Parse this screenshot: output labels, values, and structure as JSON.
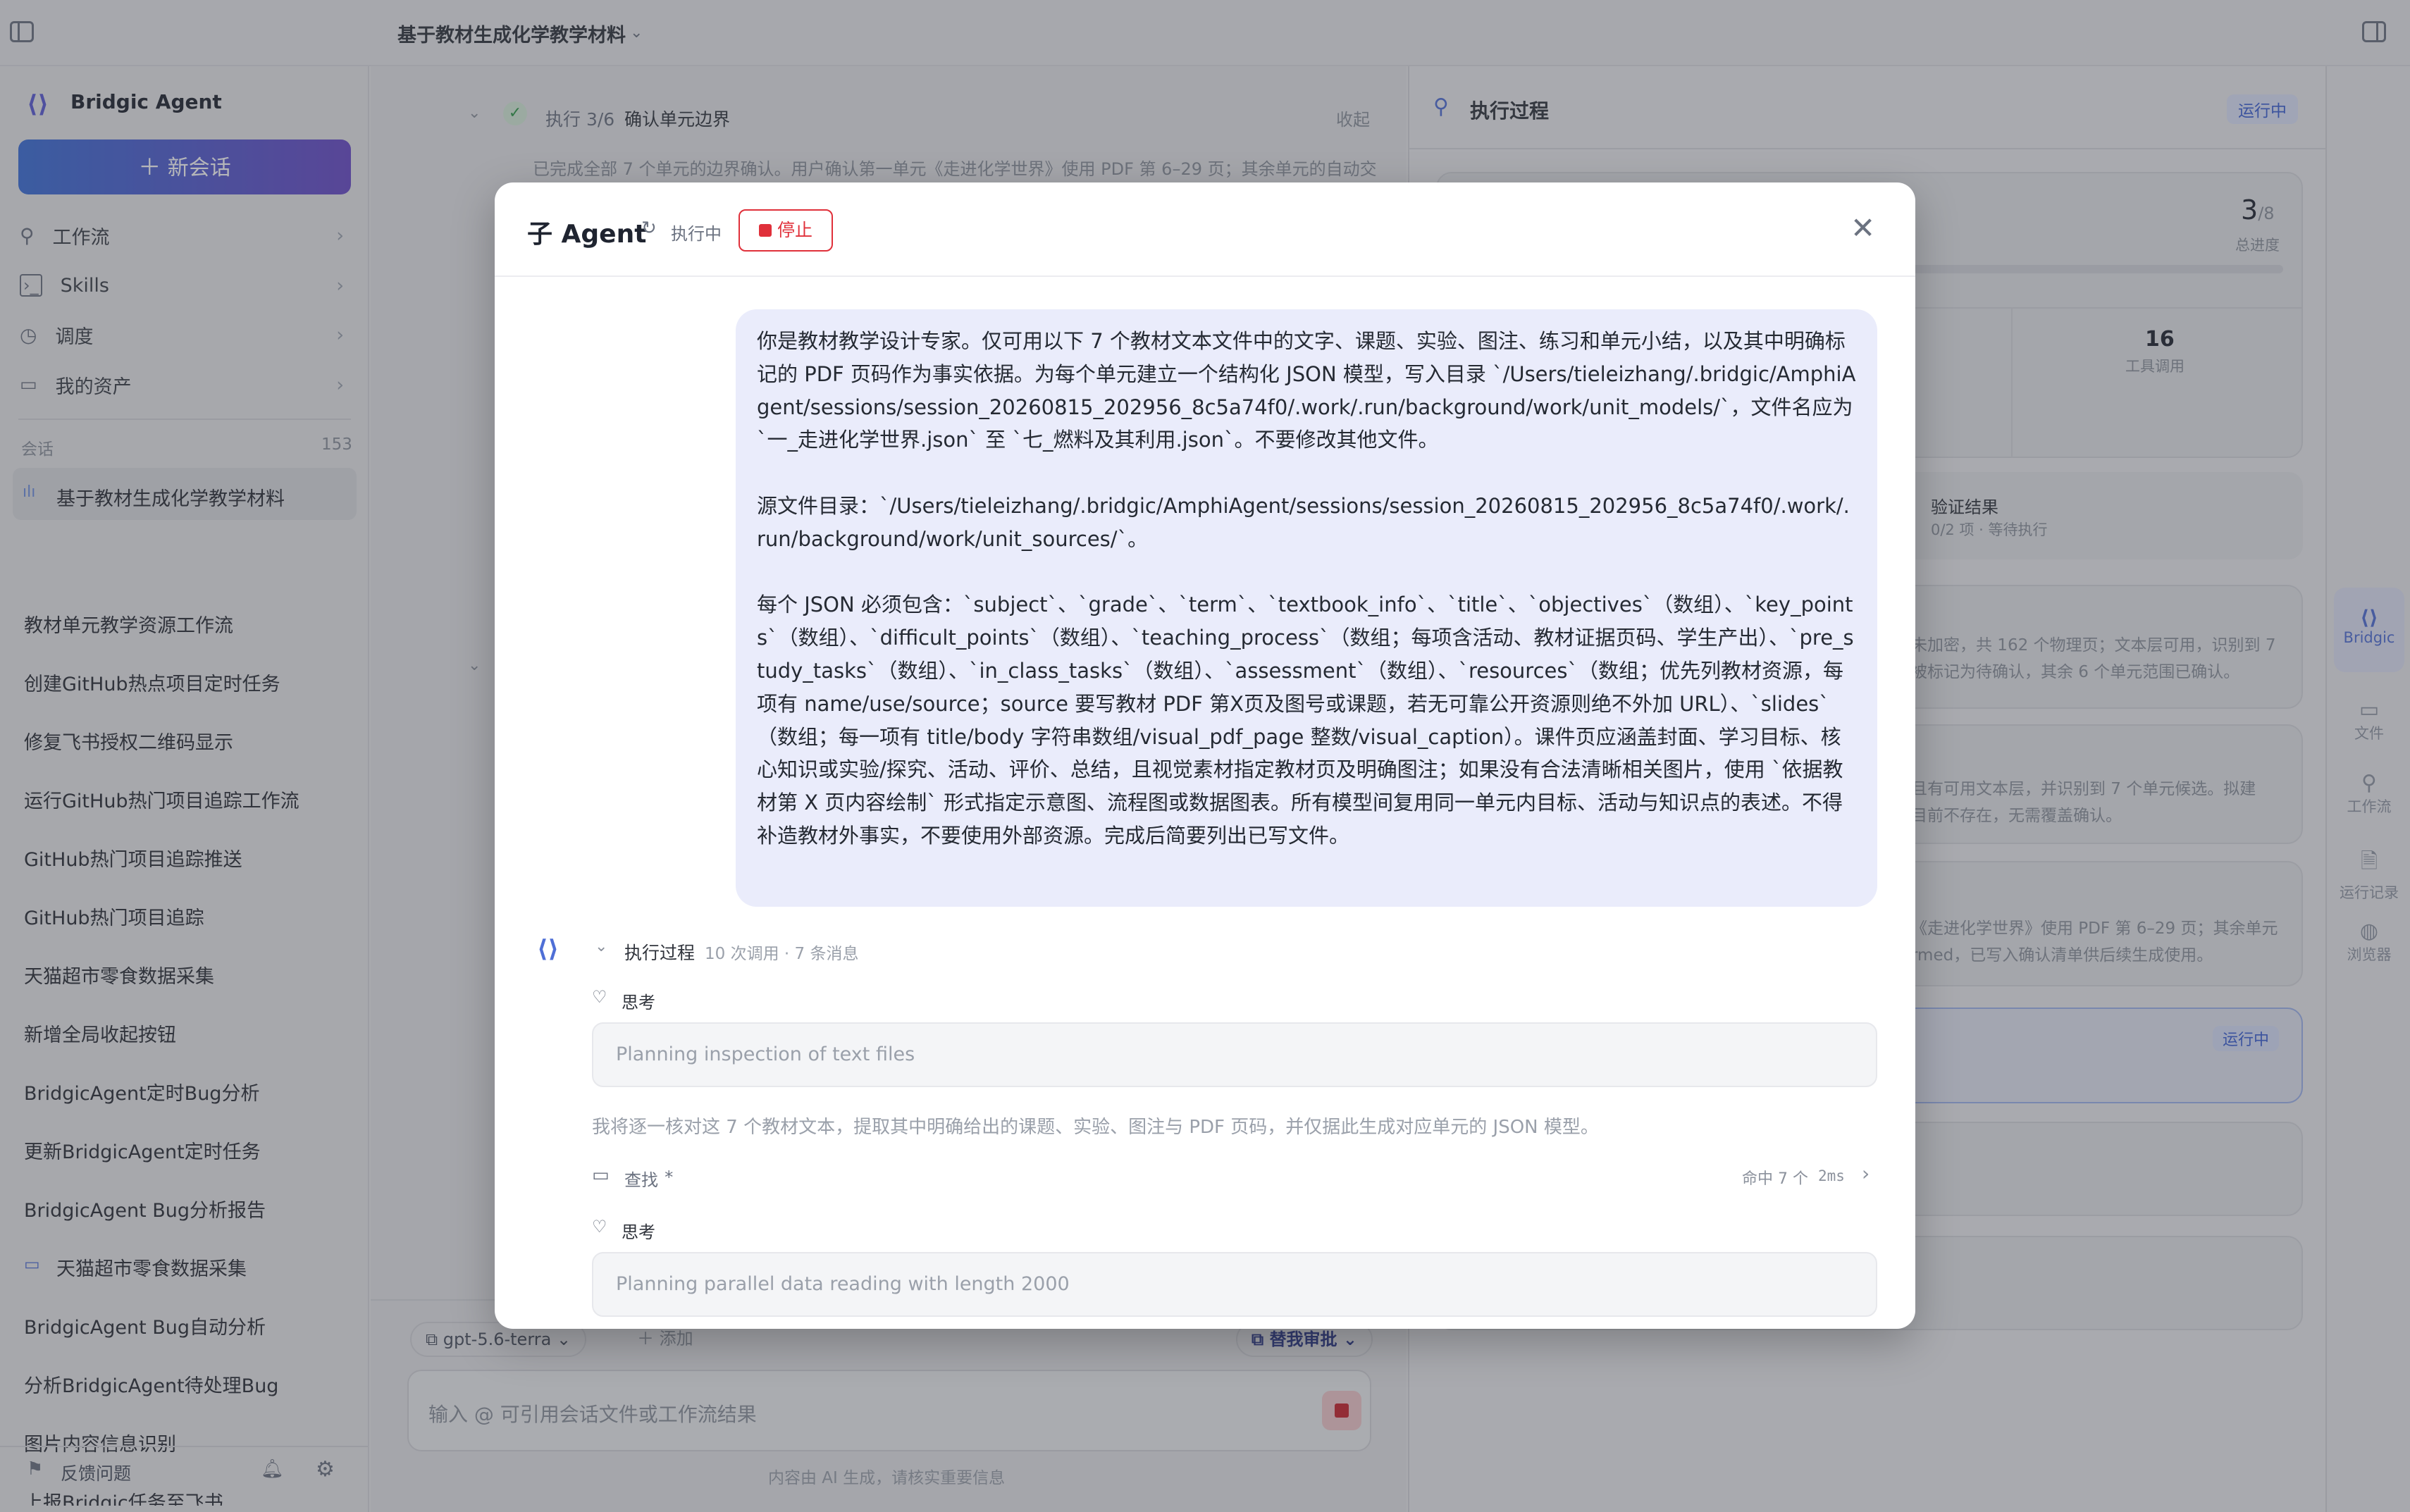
{
  "topbar": {
    "title": "基于教材生成化学教学材料"
  },
  "sidebar": {
    "brand": "Bridgic Agent",
    "new_chat": "新会话",
    "nav": [
      {
        "label": "工作流",
        "icon": "workflow-icon"
      },
      {
        "label": "Skills",
        "icon": "terminal-icon"
      },
      {
        "label": "调度",
        "icon": "clock-icon"
      },
      {
        "label": "我的资产",
        "icon": "folder-icon"
      }
    ],
    "section_label": "会话",
    "count": "153",
    "conversations": [
      "基于教材生成化学教学材料",
      "教材单元教学资源工作流",
      "创建GitHub热点项目定时任务",
      "修复飞书授权二维码显示",
      "运行GitHub热门项目追踪工作流",
      "GitHub热门项目追踪推送",
      "GitHub热门项目追踪",
      "天猫超市零食数据采集",
      "新增全局收起按钮",
      "BridgicAgent定时Bug分析",
      "更新BridgicAgent定时任务",
      "BridgicAgent Bug分析报告",
      "天猫超市零食数据采集",
      "BridgicAgent Bug自动分析",
      "分析BridgicAgent待处理Bug",
      "图片内容信息识别",
      "上报Bridgic任务至飞书"
    ],
    "feedback": "反馈问题"
  },
  "main": {
    "step_label": "执行 3/6",
    "step_title": "确认单元边界",
    "collapse": "收起",
    "step_desc": "已完成全部 7 个单元的边界确认。用户确认第一单元《走进化学世界》使用 PDF 第 6–29 页；其余单元的自动交",
    "model": "gpt-5.6-terra",
    "add": "添加",
    "approve": "替我审批",
    "input_placeholder": "输入 @ 可引用会话文件或工作流结果",
    "disclaimer": "内容由 AI 生成，请核实重要信息"
  },
  "right_panel": {
    "title": "执行过程",
    "status": "运行中",
    "progress_value": "3",
    "progress_total": "/8",
    "progress_label": "总进度",
    "tool_calls_value": "16",
    "tool_calls_label": "工具调用",
    "verify_title": "验证结果",
    "verify_sub": "0/2 项 · 等待执行",
    "card1_text": "未加密，共 162 个物理页；文本层可用，识别到 7",
    "card1_text2": "被标记为待确认，其余 6 个单元范围已确认。",
    "card2_text": "且有可用文本层，并识别到 7 个单元候选。拟建",
    "card2_text2": "目前不存在，无需覆盖确认。",
    "card3_text": "《走进化学世界》使用 PDF 第 6–29 页；其余单元",
    "card3_text2": "rmed，已写入确认清单供后续生成使用。",
    "card4_status": "运行中"
  },
  "rail": {
    "items": [
      "Bridgic",
      "文件",
      "工作流",
      "运行记录",
      "浏览器"
    ]
  },
  "modal": {
    "title": "子 Agent",
    "state": "执行中",
    "stop": "停止",
    "prompt": "你是教材教学设计专家。仅可用以下 7 个教材文本文件中的文字、课题、实验、图注、练习和单元小结，以及其中明确标记的 PDF 页码作为事实依据。为每个单元建立一个结构化 JSON 模型，写入目录 `/Users/tieleizhang/.bridgic/AmphiAgent/sessions/session_20260815_202956_8c5a74f0/.work/.run/background/work/unit_models/`，文件名应为 `一_走进化学世界.json` 至 `七_燃料及其利用.json`。不要修改其他文件。\n\n源文件目录：`/Users/tieleizhang/.bridgic/AmphiAgent/sessions/session_20260815_202956_8c5a74f0/.work/.run/background/work/unit_sources/`。\n\n每个 JSON 必须包含：`subject`、`grade`、`term`、`textbook_info`、`title`、`objectives`（数组）、`key_points`（数组）、`difficult_points`（数组）、`teaching_process`（数组；每项含活动、教材证据页码、学生产出）、`pre_study_tasks`（数组）、`in_class_tasks`（数组）、`assessment`（数组）、`resources`（数组；优先列教材资源，每项有 name/use/source；source 要写教材 PDF 第X页及图号或课题，若无可靠公开资源则绝不外加 URL）、`slides`（数组；每一项有 title/body 字符串数组/visual_pdf_page 整数/visual_caption）。课件页应涵盖封面、学习目标、核心知识或实验/探究、活动、评价、总结，且视觉素材指定教材页及明确图注；如果没有合法清晰相关图片，使用 `依据教材第 X 页内容绘制` 形式指定示意图、流程图或数据图表。所有模型间复用同一单元内目标、活动与知识点的表述。不得补造教材外事实，不要使用外部资源。完成后简要列出已写文件。",
    "process_label": "执行过程",
    "process_meta": "10 次调用 · 7 条消息",
    "think_label": "思考",
    "think1": "Planning inspection of text files",
    "reply": "我将逐一核对这 7 个教材文本，提取其中明确给出的课题、实验、图注与 PDF 页码，并仅据此生成对应单元的 JSON 模型。",
    "search_label": "查找",
    "search_arg": "*",
    "search_result": "命中 7 个",
    "search_time": "2ms",
    "think2_label": "思考",
    "think2": "Planning parallel data reading with length 2000"
  },
  "colors": {
    "accent": "#5b5bd6",
    "stop": "#e0303a",
    "brand_gradient_start": "#3b6fd8",
    "brand_gradient_end": "#6a4bc8"
  }
}
